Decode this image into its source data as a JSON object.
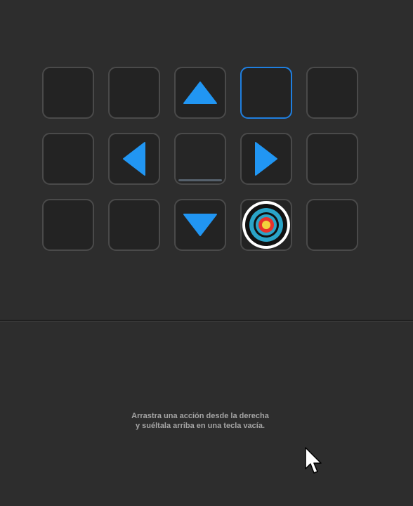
{
  "colors": {
    "background": "#2d2d2d",
    "key_fill": "#232323",
    "key_border": "#4a4a4a",
    "selected_border": "#1f7fe0",
    "arrow_blue": "#2196f3"
  },
  "key_grid": {
    "rows": 3,
    "columns": 5,
    "keys": [
      {
        "row": 1,
        "col": 1,
        "icon": "empty"
      },
      {
        "row": 1,
        "col": 2,
        "icon": "empty"
      },
      {
        "row": 1,
        "col": 3,
        "icon": "arrow-up-icon"
      },
      {
        "row": 1,
        "col": 4,
        "icon": "empty",
        "state": "selected"
      },
      {
        "row": 1,
        "col": 5,
        "icon": "empty"
      },
      {
        "row": 2,
        "col": 1,
        "icon": "empty"
      },
      {
        "row": 2,
        "col": 2,
        "icon": "arrow-left-icon"
      },
      {
        "row": 2,
        "col": 3,
        "icon": "empty",
        "state": "pressed"
      },
      {
        "row": 2,
        "col": 4,
        "icon": "arrow-right-icon"
      },
      {
        "row": 2,
        "col": 5,
        "icon": "empty"
      },
      {
        "row": 3,
        "col": 1,
        "icon": "empty"
      },
      {
        "row": 3,
        "col": 2,
        "icon": "empty"
      },
      {
        "row": 3,
        "col": 3,
        "icon": "arrow-down-icon"
      },
      {
        "row": 3,
        "col": 4,
        "icon": "target-icon"
      },
      {
        "row": 3,
        "col": 5,
        "icon": "empty"
      }
    ]
  },
  "drop_hint": {
    "line1": "Arrastra una acción desde la derecha",
    "line2": "y suéltala arriba en una tecla vacía."
  },
  "cursor": {
    "icon": "mouse-pointer-icon"
  }
}
